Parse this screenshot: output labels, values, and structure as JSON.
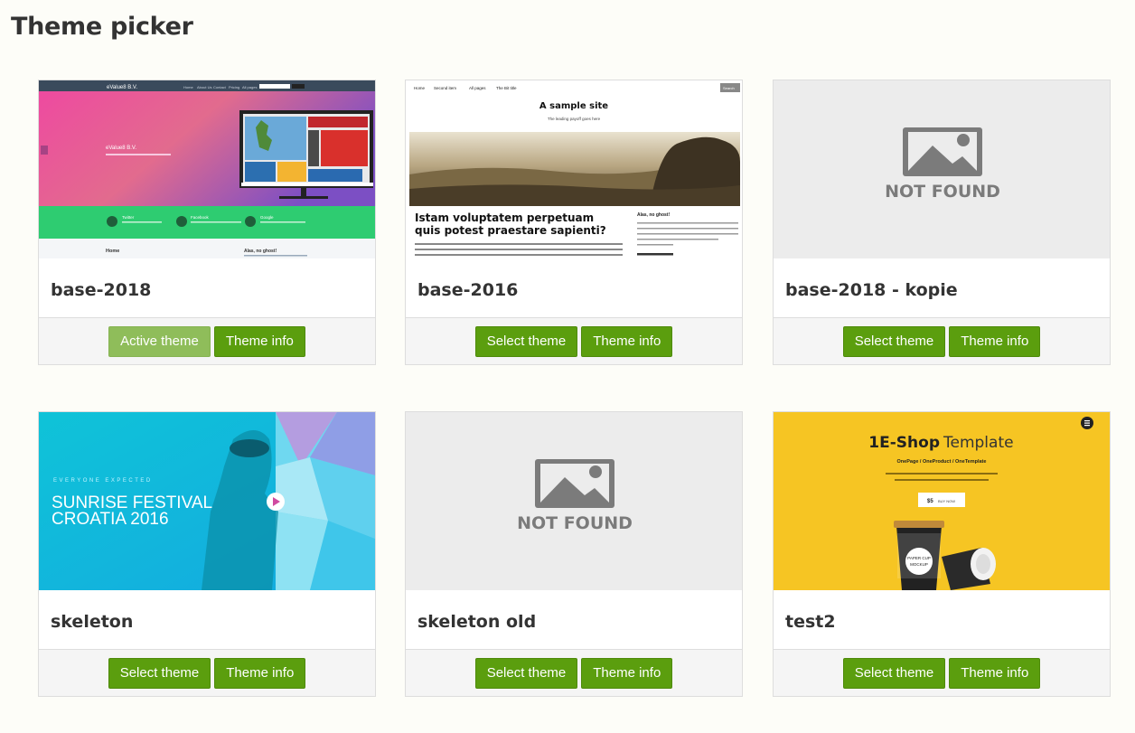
{
  "page": {
    "title": "Theme picker"
  },
  "buttons": {
    "select": "Select theme",
    "active": "Active theme",
    "info": "Theme info"
  },
  "colors": {
    "button_green": "#5b9e0e",
    "active_green": "#8fbd5a",
    "background": "#fdfdf8"
  },
  "themes": [
    {
      "name": "base-2018",
      "status": "active",
      "preview": {
        "brand": "eValue8 B.V.",
        "nav": [
          "Home",
          "About Us",
          "Contact",
          "Pricing",
          "All pages"
        ],
        "social": [
          "Twitter",
          "Facebook",
          "Google"
        ],
        "footer_headings": [
          "Home",
          "Alas, no ghost!"
        ]
      }
    },
    {
      "name": "base-2016",
      "status": "available",
      "preview": {
        "nav": [
          "Home",
          "Second item",
          "All pages",
          "The Bit title"
        ],
        "search": "Search",
        "site_title": "A sample site",
        "tagline": "The leading payoff goes here",
        "headline": [
          "Istam voluptatem perpetuam",
          "quis potest praestare sapienti?"
        ],
        "sidebar_heading": "Alas, no ghost!"
      }
    },
    {
      "name": "base-2018 - kopie",
      "status": "available",
      "preview": {
        "placeholder": "NOT FOUND"
      }
    },
    {
      "name": "skeleton",
      "status": "available",
      "preview": {
        "kicker": "EVERYONE EXPECTED",
        "headline": [
          "SUNRISE FESTIVAL",
          "CROATIA 2016"
        ]
      }
    },
    {
      "name": "skeleton old",
      "status": "available",
      "preview": {
        "placeholder": "NOT FOUND"
      }
    },
    {
      "name": "test2",
      "status": "available",
      "preview": {
        "title_bold": "1E-Shop",
        "title_light": "Template",
        "subtitle": "OnePage / OneProduct / OneTemplate",
        "price": "$5",
        "buy": "BUY NOW",
        "cup_text": [
          "PAPER CUP",
          "MOCKUP"
        ]
      }
    }
  ]
}
